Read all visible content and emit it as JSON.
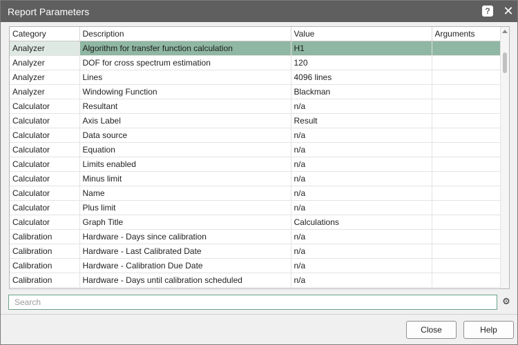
{
  "window": {
    "title": "Report Parameters"
  },
  "icons": {
    "help": "?",
    "close": "✕",
    "gear": "⚙"
  },
  "table": {
    "columns": [
      "Category",
      "Description",
      "Value",
      "Arguments"
    ],
    "rows": [
      [
        "Analyzer",
        "Algorithm for transfer function calculation",
        "H1",
        ""
      ],
      [
        "Analyzer",
        "DOF for cross spectrum estimation",
        "120",
        ""
      ],
      [
        "Analyzer",
        "Lines",
        "4096 lines",
        ""
      ],
      [
        "Analyzer",
        "Windowing Function",
        "Blackman",
        ""
      ],
      [
        "Calculator",
        "Resultant",
        "n/a",
        ""
      ],
      [
        "Calculator",
        "Axis Label",
        "Result",
        ""
      ],
      [
        "Calculator",
        "Data source",
        "n/a",
        ""
      ],
      [
        "Calculator",
        "Equation",
        "n/a",
        ""
      ],
      [
        "Calculator",
        "Limits enabled",
        "n/a",
        ""
      ],
      [
        "Calculator",
        "Minus limit",
        "n/a",
        ""
      ],
      [
        "Calculator",
        "Name",
        "n/a",
        ""
      ],
      [
        "Calculator",
        "Plus limit",
        "n/a",
        ""
      ],
      [
        "Calculator",
        "Graph Title",
        "Calculations",
        ""
      ],
      [
        "Calibration",
        "Hardware - Days since calibration",
        "n/a",
        ""
      ],
      [
        "Calibration",
        "Hardware - Last Calibrated Date",
        "n/a",
        ""
      ],
      [
        "Calibration",
        "Hardware - Calibration Due Date",
        "n/a",
        ""
      ],
      [
        "Calibration",
        "Hardware - Days until calibration scheduled",
        "n/a",
        ""
      ]
    ],
    "selected_row": 0
  },
  "search": {
    "placeholder": "Search",
    "value": ""
  },
  "buttons": {
    "close": "Close",
    "help": "Help"
  },
  "colors": {
    "titlebar": "#5f5f5f",
    "selection": "#8fb7a3",
    "accent": "#6aa286"
  }
}
